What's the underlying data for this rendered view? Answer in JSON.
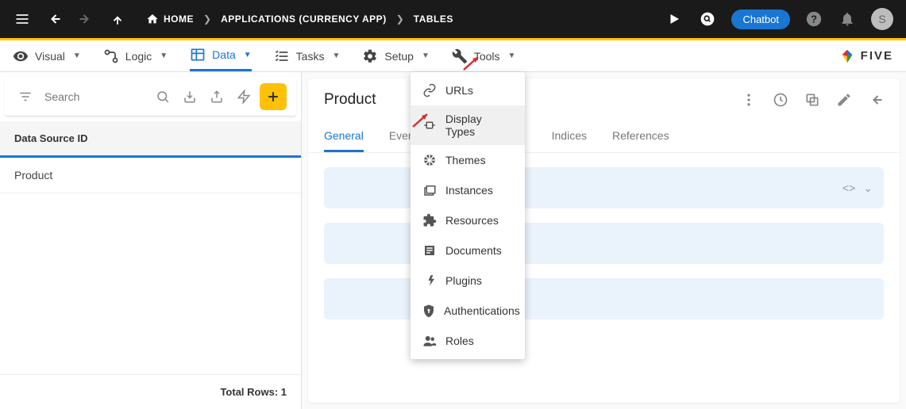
{
  "topbar": {
    "home_label": "HOME",
    "bc2": "APPLICATIONS (CURRENCY APP)",
    "bc3": "TABLES",
    "chatbot_label": "Chatbot",
    "avatar_initial": "S"
  },
  "tabs": {
    "visual": "Visual",
    "logic": "Logic",
    "data": "Data",
    "tasks": "Tasks",
    "setup": "Setup",
    "tools": "Tools",
    "brand": "FIVE"
  },
  "sidebar": {
    "search_placeholder": "Search",
    "column_header": "Data Source ID",
    "rows": [
      "Product"
    ],
    "total_label": "Total Rows: 1"
  },
  "content": {
    "title": "Product",
    "tabs": {
      "general": "General",
      "events": "Events",
      "indices": "Indices",
      "references": "References"
    }
  },
  "dropdown": {
    "items": [
      {
        "icon": "link",
        "label": "URLs"
      },
      {
        "icon": "display-types",
        "label": "Display Types"
      },
      {
        "icon": "themes",
        "label": "Themes"
      },
      {
        "icon": "instances",
        "label": "Instances"
      },
      {
        "icon": "resources",
        "label": "Resources"
      },
      {
        "icon": "documents",
        "label": "Documents"
      },
      {
        "icon": "plugins",
        "label": "Plugins"
      },
      {
        "icon": "auth",
        "label": "Authentications"
      },
      {
        "icon": "roles",
        "label": "Roles"
      }
    ]
  }
}
